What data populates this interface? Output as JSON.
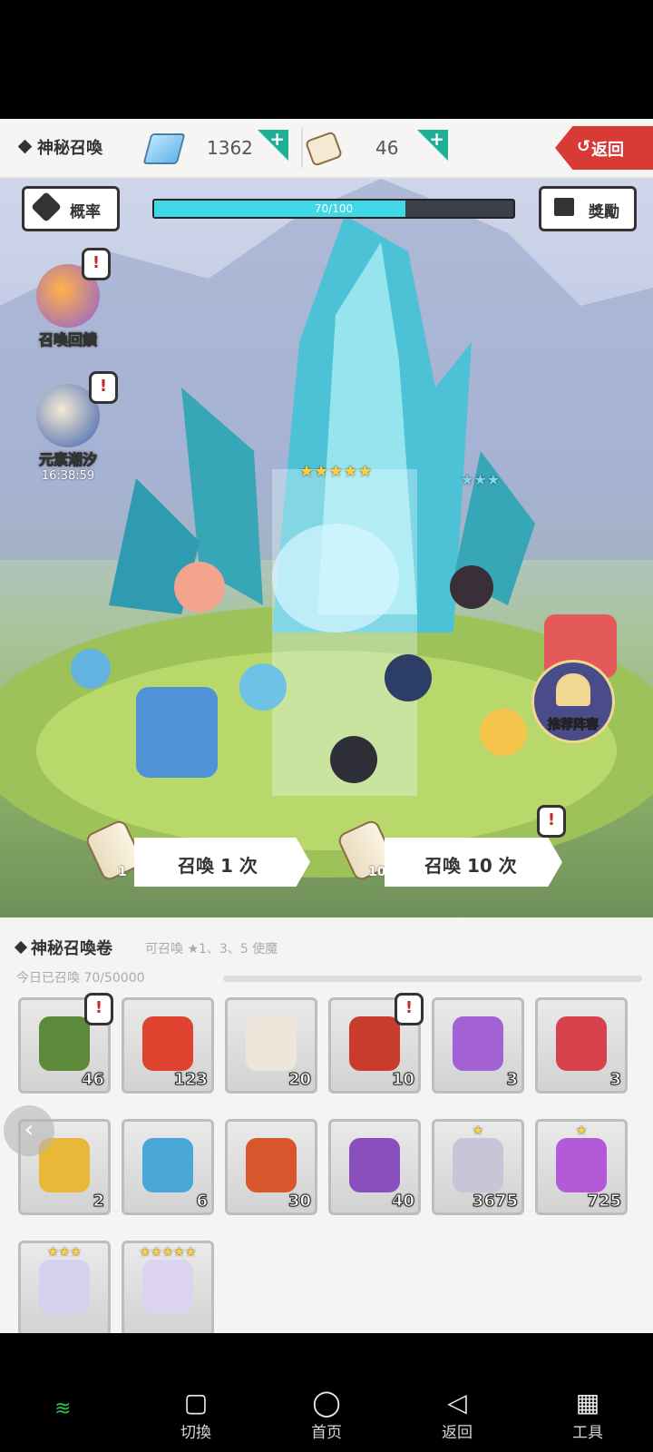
{
  "topbar": {
    "title": "神秘召喚",
    "gems": "1362",
    "scrolls": "46",
    "back_label": "返回",
    "plus": "+"
  },
  "scene": {
    "rate_label": "概率",
    "reward_label": "獎勵",
    "progress_text": "70/100",
    "progress_fraction": 0.7,
    "side_buttons": [
      {
        "label": "召喚回饋"
      },
      {
        "label": "元素潮汐",
        "timer": "16:38:59"
      }
    ],
    "recommend_label": "推荐阵容",
    "summon_one": {
      "label": "召喚 1 次",
      "count": "1"
    },
    "summon_ten": {
      "label": "召喚 10 次",
      "count": "10"
    },
    "alert": "!",
    "stars_left": "★★★★★",
    "stars_right": "★★★"
  },
  "inventory": {
    "title": "神秘召喚卷",
    "hint": "可召喚 ★1、3、5 使魔",
    "today": "今日已召喚 70/50000",
    "items": [
      {
        "count": "46",
        "color": "#5c8a3a",
        "alert": true
      },
      {
        "count": "123",
        "color": "#e0432f",
        "alert": false
      },
      {
        "count": "20",
        "color": "#efe6db",
        "alert": false
      },
      {
        "count": "10",
        "color": "#c93b2c",
        "alert": true
      },
      {
        "count": "3",
        "color": "#a361d6",
        "alert": false
      },
      {
        "count": "3",
        "color": "#d8424d",
        "alert": false
      },
      {
        "count": "2",
        "color": "#e8b838",
        "alert": false
      },
      {
        "count": "6",
        "color": "#4aa8d8",
        "alert": false
      },
      {
        "count": "30",
        "color": "#d9562d",
        "alert": false
      },
      {
        "count": "40",
        "color": "#8a4fbd",
        "alert": false
      },
      {
        "count": "3675",
        "color": "#c9c4d8",
        "stars": "★",
        "alert": false
      },
      {
        "count": "725",
        "color": "#b35ad9",
        "stars": "★",
        "alert": false
      },
      {
        "count": "",
        "color": "#d6d0ee",
        "stars": "★★★",
        "alert": false
      },
      {
        "count": "",
        "color": "#dcd4ee",
        "stars": "★★★★★",
        "alert": false
      }
    ]
  },
  "nav": {
    "items": [
      {
        "label": "切換",
        "glyph": "▢"
      },
      {
        "label": "首页",
        "glyph": "◯"
      },
      {
        "label": "返回",
        "glyph": "◁"
      },
      {
        "label": "工具",
        "glyph": "▦"
      }
    ]
  },
  "colors": {
    "accent": "#1fae96",
    "back": "#d83a36",
    "progress": "#3ed8e6"
  }
}
